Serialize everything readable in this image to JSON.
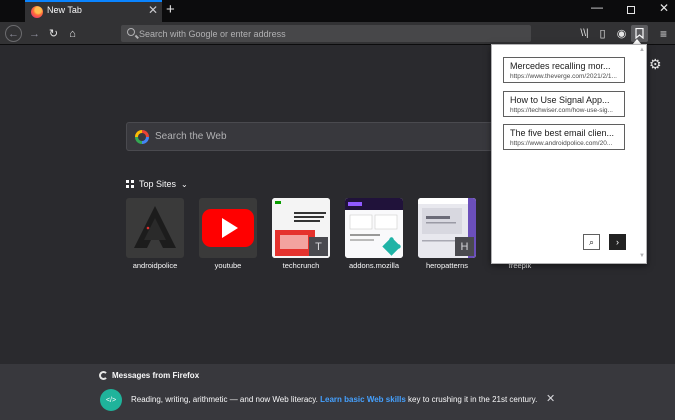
{
  "tab": {
    "title": "New Tab",
    "close": "✕",
    "new_tab": "+"
  },
  "window": {
    "minimize": "—",
    "close": "✕"
  },
  "nav": {
    "back": "←",
    "forward": "→",
    "reload": "↻",
    "home": "⌂",
    "url_placeholder": "Search with Google or enter address",
    "library": "\\\\|",
    "sidebar": "▯",
    "account": "◉",
    "extension": "⬚",
    "menu": "≡"
  },
  "settings_icon": "⚙",
  "search": {
    "placeholder": "Search the Web"
  },
  "top_sites": {
    "heading": "Top Sites",
    "chevron": "⌄",
    "sites": [
      {
        "label": "androidpolice"
      },
      {
        "label": "youtube"
      },
      {
        "label": "techcrunch",
        "badge": "T"
      },
      {
        "label": "addons.mozilla"
      },
      {
        "label": "heropatterns",
        "badge": "H"
      },
      {
        "label": "freepik"
      }
    ]
  },
  "messages": {
    "heading": "Messages from Firefox",
    "icon_text": "</>",
    "text_before": "Reading, writing, arithmetic — and now Web literacy.",
    "link": "Learn basic Web skills",
    "text_after": "key to crushing it in the 21st century.",
    "close": "✕"
  },
  "popup": {
    "items": [
      {
        "title": "Mercedes recalling mor...",
        "url": "https://www.theverge.com/2021/2/1..."
      },
      {
        "title": "How to Use Signal App...",
        "url": "https://techwiser.com/how-use-sig..."
      },
      {
        "title": "The five best email clien...",
        "url": "https://www.androidpolice.com/20..."
      }
    ],
    "search_icon": "⌕",
    "next_icon": "›",
    "scroll_up": "▲",
    "scroll_down": "▼"
  },
  "colors": {
    "accent": "#0a84ff",
    "link": "#45a1ff",
    "youtube": "#ff0000",
    "message_icon": "#1fb39b"
  }
}
